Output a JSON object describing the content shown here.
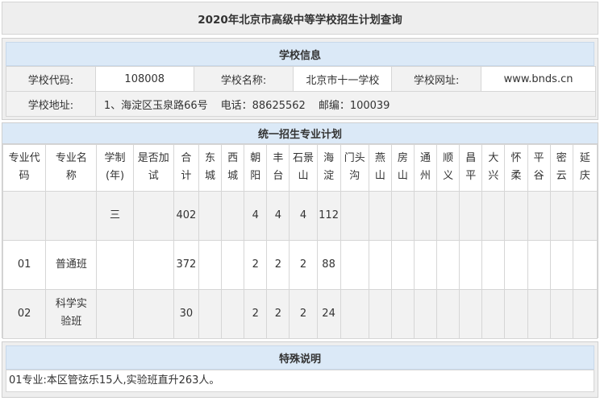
{
  "title": "2020年北京市高级中等学校招生计划查询",
  "school_info": {
    "header": "学校信息",
    "code_label": "学校代码:",
    "code_value": "108008",
    "name_label": "学校名称:",
    "name_value": "北京市十一学校",
    "website_label": "学校网址:",
    "website_value": "www.bnds.cn",
    "address_label": "学校地址:",
    "address_value": "1、海淀区玉泉路66号",
    "phone_text": "电话：88625562",
    "postcode_text": "邮编：100039"
  },
  "plan": {
    "header": "统一招生专业计划",
    "columns": [
      "专业代码",
      "专业名称",
      "学制(年)",
      "是否加试",
      "合计",
      "东城",
      "西城",
      "朝阳",
      "丰台",
      "石景山",
      "海淀",
      "门头沟",
      "燕山",
      "房山",
      "通州",
      "顺义",
      "昌平",
      "大兴",
      "怀柔",
      "平谷",
      "密云",
      "延庆"
    ],
    "column_display": [
      "专业代<br>码",
      "专业名<br>称",
      "学制<br>(年)",
      "是否加<br>试",
      "合<br>计",
      "东<br>城",
      "西<br>城",
      "朝<br>阳",
      "丰<br>台",
      "石景<br>山",
      "海<br>淀",
      "门头<br>沟",
      "燕<br>山",
      "房<br>山",
      "通<br>州",
      "顺<br>义",
      "昌<br>平",
      "大<br>兴",
      "怀<br>柔",
      "平<br>谷",
      "密<br>云",
      "延<br>庆"
    ],
    "rows": [
      {
        "code": "",
        "name": "",
        "years": "三",
        "extra": "",
        "total": "402",
        "dongcheng": "",
        "xicheng": "",
        "chaoyang": "4",
        "fengtai": "4",
        "shijingshan": "4",
        "haidian": "112",
        "mentougou": "",
        "yanshan": "",
        "fangshan": "",
        "tongzhou": "",
        "shunyi": "",
        "changping": "",
        "daxing": "",
        "huairou": "",
        "pinggu": "",
        "miyun": "",
        "yanqing": ""
      },
      {
        "code": "01",
        "name": "普通班",
        "years": "",
        "extra": "",
        "total": "372",
        "dongcheng": "",
        "xicheng": "",
        "chaoyang": "2",
        "fengtai": "2",
        "shijingshan": "2",
        "haidian": "88",
        "mentougou": "",
        "yanshan": "",
        "fangshan": "",
        "tongzhou": "",
        "shunyi": "",
        "changping": "",
        "daxing": "",
        "huairou": "",
        "pinggu": "",
        "miyun": "",
        "yanqing": ""
      },
      {
        "code": "02",
        "name": "科学实验班",
        "years": "",
        "extra": "",
        "total": "30",
        "dongcheng": "",
        "xicheng": "",
        "chaoyang": "2",
        "fengtai": "2",
        "shijingshan": "2",
        "haidian": "24",
        "mentougou": "",
        "yanshan": "",
        "fangshan": "",
        "tongzhou": "",
        "shunyi": "",
        "changping": "",
        "daxing": "",
        "huairou": "",
        "pinggu": "",
        "miyun": "",
        "yanqing": ""
      }
    ],
    "row3_name_display": "科学实<br>验班"
  },
  "notes": {
    "header": "特殊说明",
    "text": "01专业:本区管弦乐15人,实验班直升263人。"
  }
}
